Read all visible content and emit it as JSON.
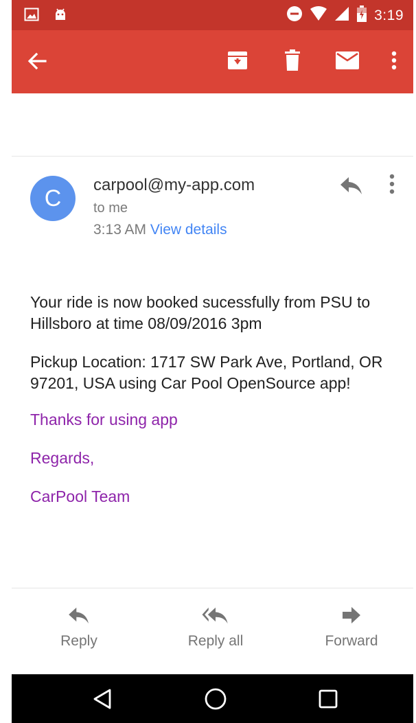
{
  "status_bar": {
    "time": "3:19",
    "icons": [
      "image-icon",
      "android-icon",
      "do-not-disturb-icon",
      "wifi-icon",
      "signal-icon",
      "battery-icon"
    ]
  },
  "app_bar": {
    "icons": [
      "back-arrow-icon",
      "archive-icon",
      "delete-icon",
      "mail-icon",
      "more-vert-icon"
    ],
    "color": "#db4437"
  },
  "email": {
    "avatar_letter": "C",
    "avatar_color": "#5c93ed",
    "sender": "carpool@my-app.com",
    "recipient": "to me",
    "time": "3:13 AM",
    "view_details": "View details",
    "body": {
      "paragraph_1": "Your ride is now booked sucessfully from PSU to Hillsboro at time 08/09/2016 3pm",
      "paragraph_2": "Pickup Location: 1717 SW Park Ave, Portland, OR 97201, USA using Car Pool OpenSource app!",
      "signature_1": "Thanks for using app",
      "signature_2": "Regards,",
      "signature_3": "CarPool Team"
    }
  },
  "footer": {
    "reply": "Reply",
    "reply_all": "Reply all",
    "forward": "Forward"
  },
  "nav_bar": {
    "icons": [
      "nav-back-icon",
      "nav-home-icon",
      "nav-recents-icon"
    ]
  }
}
